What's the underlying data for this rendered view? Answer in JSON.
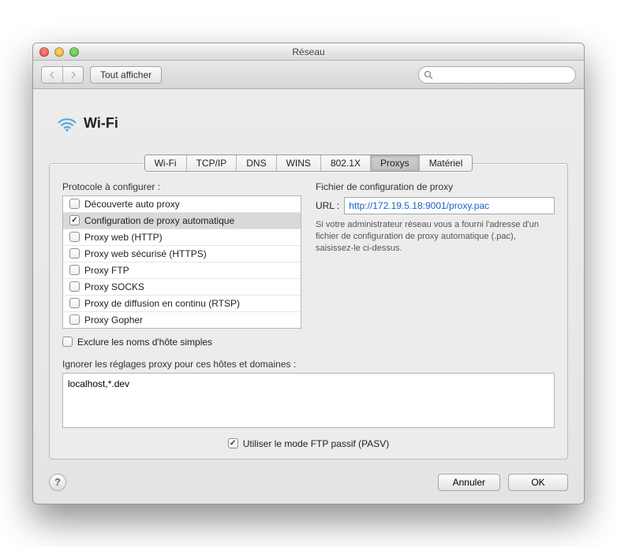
{
  "window": {
    "title": "Réseau"
  },
  "toolbar": {
    "showAll": "Tout afficher",
    "searchPlaceholder": ""
  },
  "header": {
    "interface": "Wi-Fi"
  },
  "tabs": [
    "Wi-Fi",
    "TCP/IP",
    "DNS",
    "WINS",
    "802.1X",
    "Proxys",
    "Matériel"
  ],
  "activeTabIndex": 5,
  "proxy": {
    "protocolLabel": "Protocole à configurer :",
    "protocols": [
      {
        "label": "Découverte auto proxy",
        "checked": false,
        "selected": false
      },
      {
        "label": "Configuration de proxy automatique",
        "checked": true,
        "selected": true
      },
      {
        "label": "Proxy web (HTTP)",
        "checked": false,
        "selected": false
      },
      {
        "label": "Proxy web sécurisé (HTTPS)",
        "checked": false,
        "selected": false
      },
      {
        "label": "Proxy FTP",
        "checked": false,
        "selected": false
      },
      {
        "label": "Proxy SOCKS",
        "checked": false,
        "selected": false
      },
      {
        "label": "Proxy de diffusion en continu (RTSP)",
        "checked": false,
        "selected": false
      },
      {
        "label": "Proxy Gopher",
        "checked": false,
        "selected": false
      }
    ],
    "rightTitle": "Fichier de configuration de proxy",
    "urlLabel": "URL :",
    "urlValue": "http://172.19.5.18:9001/proxy.pac",
    "hint": "Si votre administrateur réseau vous a fourni l'adresse d'un fichier de configuration de proxy automatique (.pac), saisissez-le ci-dessus.",
    "excludeSimple": {
      "label": "Exclure les noms d'hôte simples",
      "checked": false
    },
    "bypassLabel": "Ignorer les réglages proxy pour ces hôtes et domaines :",
    "bypassValue": "localhost,*.dev",
    "ftpPassive": {
      "label": "Utiliser le mode FTP passif (PASV)",
      "checked": true
    }
  },
  "buttons": {
    "cancel": "Annuler",
    "ok": "OK"
  }
}
